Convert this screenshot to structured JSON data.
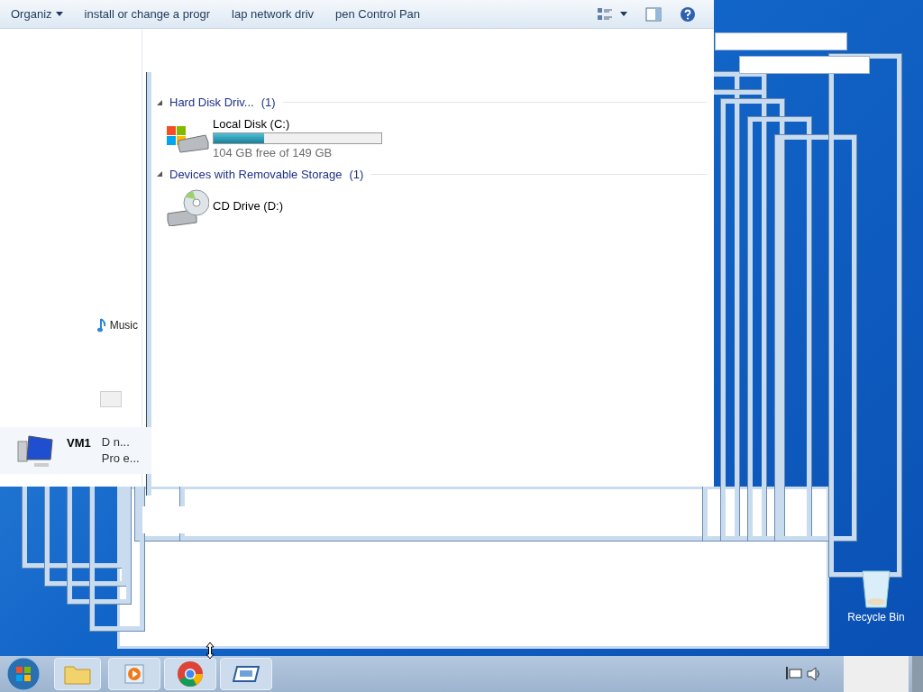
{
  "toolbar": {
    "items": [
      {
        "label": "Organiz",
        "menu": true
      },
      {
        "label": "install or change a progr",
        "menu": false
      },
      {
        "label": "lap network driv",
        "menu": false
      },
      {
        "label": "pen Control Pan",
        "menu": false
      }
    ]
  },
  "groups": [
    {
      "title": "Hard Disk Driv...",
      "count": "(1)",
      "drives": [
        {
          "kind": "disk",
          "name": "Local Disk (C:)",
          "level": 0.3,
          "free": "104 GB free of 149 GB"
        }
      ]
    },
    {
      "title": "Devices with Removable Storage",
      "count": "(1)",
      "drives": [
        {
          "kind": "cd",
          "name": "CD Drive (D:)"
        }
      ]
    }
  ],
  "nav": {
    "label": "Music"
  },
  "computer": {
    "name": "VM1",
    "line_1": "D n...",
    "line_2": "Pro e..."
  },
  "desktop": {
    "recycle_bin": "Recycle Bin"
  }
}
